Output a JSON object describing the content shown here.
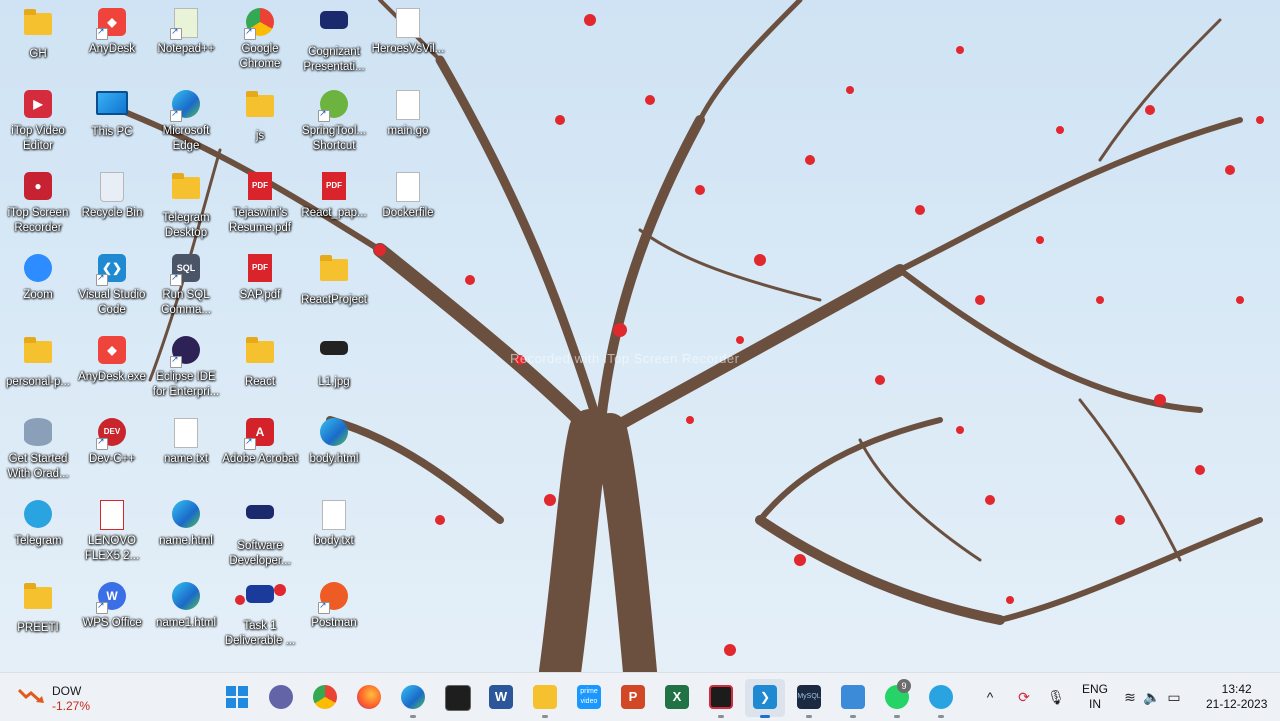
{
  "wallpaper": {
    "watermark": "Recorded with iTop Screen Recorder"
  },
  "desktop_icons": [
    {
      "label": "GH"
    },
    {
      "label": "AnyDesk"
    },
    {
      "label": "Notepad++"
    },
    {
      "label": "Google Chrome"
    },
    {
      "label": "Cognizant Presentati..."
    },
    {
      "label": "HeroesVsVil..."
    },
    {
      "label": "iTop Video Editor"
    },
    {
      "label": "This PC"
    },
    {
      "label": "Microsoft Edge"
    },
    {
      "label": "js"
    },
    {
      "label": "SpringTool... Shortcut"
    },
    {
      "label": "main.go"
    },
    {
      "label": "iTop Screen Recorder"
    },
    {
      "label": "Recycle Bin"
    },
    {
      "label": "Telegram Desktop"
    },
    {
      "label": "Tejaswini's Resume.pdf"
    },
    {
      "label": "React_pap..."
    },
    {
      "label": "Dockerfile"
    },
    {
      "label": "Zoom"
    },
    {
      "label": "Visual Studio Code"
    },
    {
      "label": "Run SQL Comma..."
    },
    {
      "label": "SAP.pdf"
    },
    {
      "label": "ReactProject"
    },
    {
      "label": "personal-p..."
    },
    {
      "label": "AnyDesk.exe"
    },
    {
      "label": "Eclipse IDE for Enterpri..."
    },
    {
      "label": "React"
    },
    {
      "label": "L1.jpg"
    },
    {
      "label": "Get Started With Orad..."
    },
    {
      "label": "Dev-C++"
    },
    {
      "label": "name.txt"
    },
    {
      "label": "Adobe Acrobat"
    },
    {
      "label": "body.html"
    },
    {
      "label": "Telegram"
    },
    {
      "label": "LENOVO FLEX5 2..."
    },
    {
      "label": "name.html"
    },
    {
      "label": "Software Developer..."
    },
    {
      "label": "body.txt"
    },
    {
      "label": "PREETI"
    },
    {
      "label": "WPS Office"
    },
    {
      "label": "name1.html"
    },
    {
      "label": "Task 1 Deliverable ..."
    },
    {
      "label": "Postman"
    }
  ],
  "taskbar": {
    "weather": {
      "name": "DOW",
      "change": "-1.27%"
    },
    "apps": [
      {
        "name": "start-button"
      },
      {
        "name": "teams-icon"
      },
      {
        "name": "chrome-icon"
      },
      {
        "name": "firefox-icon"
      },
      {
        "name": "edge-icon"
      },
      {
        "name": "terminal-icon"
      },
      {
        "name": "word-icon"
      },
      {
        "name": "file-explorer-icon"
      },
      {
        "name": "prime-video-icon"
      },
      {
        "name": "powerpoint-icon"
      },
      {
        "name": "excel-icon"
      },
      {
        "name": "itop-recorder-icon"
      },
      {
        "name": "vscode-icon"
      },
      {
        "name": "mysql-icon"
      },
      {
        "name": "notepad-icon"
      },
      {
        "name": "whatsapp-icon"
      },
      {
        "name": "telegram-icon"
      }
    ],
    "whatsapp_badge": "9",
    "prime_label": "prime video",
    "mysql_label": "MySQL",
    "tray": {
      "lang_top": "ENG",
      "lang_bottom": "IN",
      "time": "13:42",
      "date": "21-12-2023"
    }
  }
}
